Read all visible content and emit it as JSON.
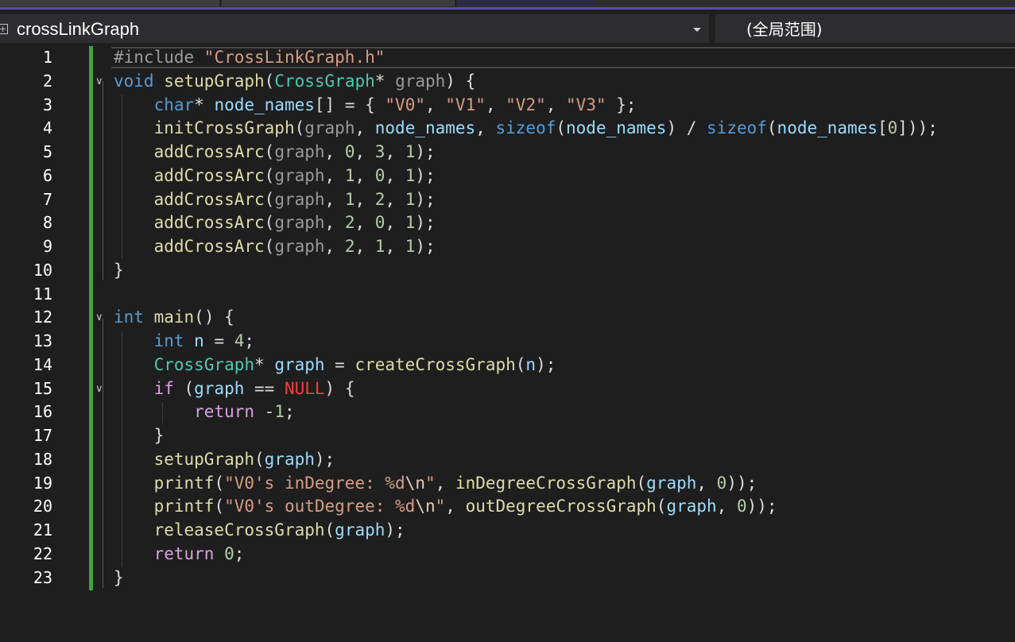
{
  "navigation_bar": {
    "scope_label": "crossLinkGraph",
    "member_label": "(全局范围)"
  },
  "code_lines": [
    {
      "number": "1",
      "tokens": [
        {
          "t": "#include ",
          "c": "pre"
        },
        {
          "t": "\"CrossLinkGraph.h\"",
          "c": "str"
        }
      ]
    },
    {
      "number": "2",
      "tokens": [
        {
          "t": "void",
          "c": "kw"
        },
        {
          "t": " ",
          "c": "plain"
        },
        {
          "t": "setupGraph",
          "c": "fn"
        },
        {
          "t": "(",
          "c": "plain"
        },
        {
          "t": "CrossGraph",
          "c": "type"
        },
        {
          "t": "* ",
          "c": "plain"
        },
        {
          "t": "graph",
          "c": "param"
        },
        {
          "t": ") {",
          "c": "plain"
        }
      ]
    },
    {
      "number": "3",
      "tokens": [
        {
          "t": "    ",
          "c": "plain"
        },
        {
          "t": "char",
          "c": "kw"
        },
        {
          "t": "* ",
          "c": "plain"
        },
        {
          "t": "node_names",
          "c": "var"
        },
        {
          "t": "[] = { ",
          "c": "plain"
        },
        {
          "t": "\"V0\"",
          "c": "str"
        },
        {
          "t": ", ",
          "c": "plain"
        },
        {
          "t": "\"V1\"",
          "c": "str"
        },
        {
          "t": ", ",
          "c": "plain"
        },
        {
          "t": "\"V2\"",
          "c": "str"
        },
        {
          "t": ", ",
          "c": "plain"
        },
        {
          "t": "\"V3\"",
          "c": "str"
        },
        {
          "t": " };",
          "c": "plain"
        }
      ]
    },
    {
      "number": "4",
      "tokens": [
        {
          "t": "    ",
          "c": "plain"
        },
        {
          "t": "initCrossGraph",
          "c": "fn"
        },
        {
          "t": "(",
          "c": "plain"
        },
        {
          "t": "graph",
          "c": "param"
        },
        {
          "t": ", ",
          "c": "plain"
        },
        {
          "t": "node_names",
          "c": "var"
        },
        {
          "t": ", ",
          "c": "plain"
        },
        {
          "t": "sizeof",
          "c": "kw"
        },
        {
          "t": "(",
          "c": "plain"
        },
        {
          "t": "node_names",
          "c": "var"
        },
        {
          "t": ") / ",
          "c": "plain"
        },
        {
          "t": "sizeof",
          "c": "kw"
        },
        {
          "t": "(",
          "c": "plain"
        },
        {
          "t": "node_names",
          "c": "var"
        },
        {
          "t": "[",
          "c": "plain"
        },
        {
          "t": "0",
          "c": "num"
        },
        {
          "t": "]));",
          "c": "plain"
        }
      ]
    },
    {
      "number": "5",
      "tokens": [
        {
          "t": "    ",
          "c": "plain"
        },
        {
          "t": "addCrossArc",
          "c": "fn"
        },
        {
          "t": "(",
          "c": "plain"
        },
        {
          "t": "graph",
          "c": "param"
        },
        {
          "t": ", ",
          "c": "plain"
        },
        {
          "t": "0",
          "c": "num"
        },
        {
          "t": ", ",
          "c": "plain"
        },
        {
          "t": "3",
          "c": "num"
        },
        {
          "t": ", ",
          "c": "plain"
        },
        {
          "t": "1",
          "c": "num"
        },
        {
          "t": ");",
          "c": "plain"
        }
      ]
    },
    {
      "number": "6",
      "tokens": [
        {
          "t": "    ",
          "c": "plain"
        },
        {
          "t": "addCrossArc",
          "c": "fn"
        },
        {
          "t": "(",
          "c": "plain"
        },
        {
          "t": "graph",
          "c": "param"
        },
        {
          "t": ", ",
          "c": "plain"
        },
        {
          "t": "1",
          "c": "num"
        },
        {
          "t": ", ",
          "c": "plain"
        },
        {
          "t": "0",
          "c": "num"
        },
        {
          "t": ", ",
          "c": "plain"
        },
        {
          "t": "1",
          "c": "num"
        },
        {
          "t": ");",
          "c": "plain"
        }
      ]
    },
    {
      "number": "7",
      "tokens": [
        {
          "t": "    ",
          "c": "plain"
        },
        {
          "t": "addCrossArc",
          "c": "fn"
        },
        {
          "t": "(",
          "c": "plain"
        },
        {
          "t": "graph",
          "c": "param"
        },
        {
          "t": ", ",
          "c": "plain"
        },
        {
          "t": "1",
          "c": "num"
        },
        {
          "t": ", ",
          "c": "plain"
        },
        {
          "t": "2",
          "c": "num"
        },
        {
          "t": ", ",
          "c": "plain"
        },
        {
          "t": "1",
          "c": "num"
        },
        {
          "t": ");",
          "c": "plain"
        }
      ]
    },
    {
      "number": "8",
      "tokens": [
        {
          "t": "    ",
          "c": "plain"
        },
        {
          "t": "addCrossArc",
          "c": "fn"
        },
        {
          "t": "(",
          "c": "plain"
        },
        {
          "t": "graph",
          "c": "param"
        },
        {
          "t": ", ",
          "c": "plain"
        },
        {
          "t": "2",
          "c": "num"
        },
        {
          "t": ", ",
          "c": "plain"
        },
        {
          "t": "0",
          "c": "num"
        },
        {
          "t": ", ",
          "c": "plain"
        },
        {
          "t": "1",
          "c": "num"
        },
        {
          "t": ");",
          "c": "plain"
        }
      ]
    },
    {
      "number": "9",
      "tokens": [
        {
          "t": "    ",
          "c": "plain"
        },
        {
          "t": "addCrossArc",
          "c": "fn"
        },
        {
          "t": "(",
          "c": "plain"
        },
        {
          "t": "graph",
          "c": "param"
        },
        {
          "t": ", ",
          "c": "plain"
        },
        {
          "t": "2",
          "c": "num"
        },
        {
          "t": ", ",
          "c": "plain"
        },
        {
          "t": "1",
          "c": "num"
        },
        {
          "t": ", ",
          "c": "plain"
        },
        {
          "t": "1",
          "c": "num"
        },
        {
          "t": ");",
          "c": "plain"
        }
      ]
    },
    {
      "number": "10",
      "tokens": [
        {
          "t": "}",
          "c": "plain"
        }
      ]
    },
    {
      "number": "11",
      "tokens": []
    },
    {
      "number": "12",
      "tokens": [
        {
          "t": "int",
          "c": "kw"
        },
        {
          "t": " ",
          "c": "plain"
        },
        {
          "t": "main",
          "c": "fn"
        },
        {
          "t": "() {",
          "c": "plain"
        }
      ]
    },
    {
      "number": "13",
      "tokens": [
        {
          "t": "    ",
          "c": "plain"
        },
        {
          "t": "int",
          "c": "kw"
        },
        {
          "t": " ",
          "c": "plain"
        },
        {
          "t": "n",
          "c": "var"
        },
        {
          "t": " = ",
          "c": "plain"
        },
        {
          "t": "4",
          "c": "num"
        },
        {
          "t": ";",
          "c": "plain"
        }
      ]
    },
    {
      "number": "14",
      "tokens": [
        {
          "t": "    ",
          "c": "plain"
        },
        {
          "t": "CrossGraph",
          "c": "type"
        },
        {
          "t": "* ",
          "c": "plain"
        },
        {
          "t": "graph",
          "c": "var"
        },
        {
          "t": " = ",
          "c": "plain"
        },
        {
          "t": "createCrossGraph",
          "c": "fn"
        },
        {
          "t": "(",
          "c": "plain"
        },
        {
          "t": "n",
          "c": "var"
        },
        {
          "t": ");",
          "c": "plain"
        }
      ]
    },
    {
      "number": "15",
      "tokens": [
        {
          "t": "    ",
          "c": "plain"
        },
        {
          "t": "if",
          "c": "flow"
        },
        {
          "t": " (",
          "c": "plain"
        },
        {
          "t": "graph",
          "c": "var"
        },
        {
          "t": " == ",
          "c": "plain"
        },
        {
          "t": "NULL",
          "c": "macro"
        },
        {
          "t": ") {",
          "c": "plain"
        }
      ]
    },
    {
      "number": "16",
      "tokens": [
        {
          "t": "        ",
          "c": "plain"
        },
        {
          "t": "return",
          "c": "flow"
        },
        {
          "t": " -",
          "c": "plain"
        },
        {
          "t": "1",
          "c": "num"
        },
        {
          "t": ";",
          "c": "plain"
        }
      ]
    },
    {
      "number": "17",
      "tokens": [
        {
          "t": "    }",
          "c": "plain"
        }
      ]
    },
    {
      "number": "18",
      "tokens": [
        {
          "t": "    ",
          "c": "plain"
        },
        {
          "t": "setupGraph",
          "c": "fn"
        },
        {
          "t": "(",
          "c": "plain"
        },
        {
          "t": "graph",
          "c": "var"
        },
        {
          "t": ");",
          "c": "plain"
        }
      ]
    },
    {
      "number": "19",
      "tokens": [
        {
          "t": "    ",
          "c": "plain"
        },
        {
          "t": "printf",
          "c": "fn"
        },
        {
          "t": "(",
          "c": "plain"
        },
        {
          "t": "\"V0's inDegree: %d",
          "c": "str"
        },
        {
          "t": "\\n",
          "c": "esc"
        },
        {
          "t": "\"",
          "c": "str"
        },
        {
          "t": ", ",
          "c": "plain"
        },
        {
          "t": "inDegreeCrossGraph",
          "c": "fn"
        },
        {
          "t": "(",
          "c": "plain"
        },
        {
          "t": "graph",
          "c": "var"
        },
        {
          "t": ", ",
          "c": "plain"
        },
        {
          "t": "0",
          "c": "num"
        },
        {
          "t": "));",
          "c": "plain"
        }
      ]
    },
    {
      "number": "20",
      "tokens": [
        {
          "t": "    ",
          "c": "plain"
        },
        {
          "t": "printf",
          "c": "fn"
        },
        {
          "t": "(",
          "c": "plain"
        },
        {
          "t": "\"V0's outDegree: %d",
          "c": "str"
        },
        {
          "t": "\\n",
          "c": "esc"
        },
        {
          "t": "\"",
          "c": "str"
        },
        {
          "t": ", ",
          "c": "plain"
        },
        {
          "t": "outDegreeCrossGraph",
          "c": "fn"
        },
        {
          "t": "(",
          "c": "plain"
        },
        {
          "t": "graph",
          "c": "var"
        },
        {
          "t": ", ",
          "c": "plain"
        },
        {
          "t": "0",
          "c": "num"
        },
        {
          "t": "));",
          "c": "plain"
        }
      ]
    },
    {
      "number": "21",
      "tokens": [
        {
          "t": "    ",
          "c": "plain"
        },
        {
          "t": "releaseCrossGraph",
          "c": "fn"
        },
        {
          "t": "(",
          "c": "plain"
        },
        {
          "t": "graph",
          "c": "var"
        },
        {
          "t": ");",
          "c": "plain"
        }
      ]
    },
    {
      "number": "22",
      "tokens": [
        {
          "t": "    ",
          "c": "plain"
        },
        {
          "t": "return",
          "c": "flow"
        },
        {
          "t": " ",
          "c": "plain"
        },
        {
          "t": "0",
          "c": "num"
        },
        {
          "t": ";",
          "c": "plain"
        }
      ]
    },
    {
      "number": "23",
      "tokens": [
        {
          "t": "}",
          "c": "plain"
        }
      ]
    }
  ],
  "token_colors": {
    "pre": "#9b9b9b",
    "kw": "#569cd6",
    "fn": "#dcdcaa",
    "type": "#4ec9b0",
    "param": "#9a9a9a",
    "var": "#9cdcfe",
    "str": "#d69d85",
    "esc": "#e8c9bb",
    "num": "#b5cea8",
    "flow": "#d8a0df",
    "macro": "#ff3a3a",
    "plain": "#dcdcdc"
  },
  "fold_markers": [
    {
      "line": "2",
      "icon": "chevron-down-icon"
    },
    {
      "line": "12",
      "icon": "chevron-down-icon"
    },
    {
      "line": "15",
      "icon": "chevron-down-icon"
    }
  ],
  "colors": {
    "background": "#1e1e1e",
    "change_bar": "#3fa13f",
    "tab_accent": "#5a4bb5"
  }
}
